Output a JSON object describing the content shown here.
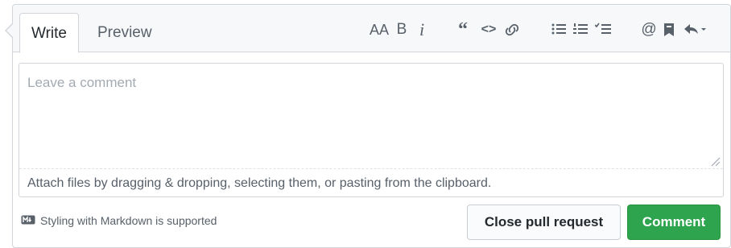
{
  "tabs": {
    "write": "Write",
    "preview": "Preview"
  },
  "toolbar": {
    "heading": "AA",
    "bold": "B",
    "italic": "i",
    "quote": "“",
    "code": "<>",
    "link_icon": "link-icon",
    "bullet_list_icon": "bullet-list-icon",
    "numbered_list_icon": "numbered-list-icon",
    "task_list_icon": "task-list-icon",
    "mention": "@",
    "saved_reply_icon": "bookmark-icon",
    "reply_icon": "reply-arrow-icon"
  },
  "editor": {
    "placeholder": "Leave a comment",
    "value": "",
    "attach_hint": "Attach files by dragging & dropping, selecting them, or pasting from the clipboard."
  },
  "footer": {
    "markdown_note": "Styling with Markdown is supported",
    "markdown_icon": "markdown-icon",
    "close_button": "Close pull request",
    "comment_button": "Comment"
  },
  "colors": {
    "primary_green": "#2ea44f",
    "border": "#d1d5da",
    "header_bg": "#f6f8fa"
  }
}
